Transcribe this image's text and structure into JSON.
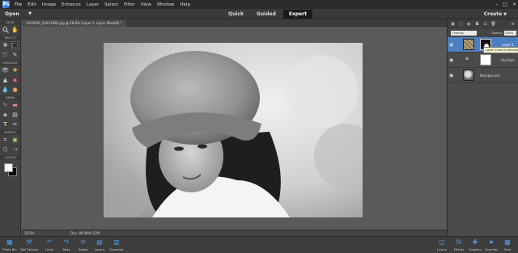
{
  "menubar": {
    "logo": "Ps",
    "items": [
      "File",
      "Edit",
      "Image",
      "Enhance",
      "Layer",
      "Select",
      "Filter",
      "View",
      "Window",
      "Help"
    ],
    "window_controls": [
      "–",
      "□",
      "✕"
    ]
  },
  "modebar": {
    "open_label": "Open",
    "tabs": [
      "Quick",
      "Guided",
      "Expert"
    ],
    "active_tab": "Expert",
    "create_label": "Create"
  },
  "toolbar": {
    "sections": [
      "VIEW",
      "SELECT",
      "ENHANCE",
      "DRAW",
      "MODIFY",
      "COLOR"
    ]
  },
  "document": {
    "tab_title": "1419045_23011694.jpg @ 28.8% (Layer 1, Layer Mask/8) *",
    "zoom": "28.8%",
    "doc_info": "Doc: 88.9M/4.52M"
  },
  "layers_panel": {
    "blend_mode": "Overlay",
    "opacity_label": "Opacity:",
    "opacity_value": "100%",
    "tooltip": "Layer mask thumbnail",
    "layers": [
      {
        "name": "Layer 1",
        "selected": true
      },
      {
        "name": "Hue/Sat...",
        "selected": false
      },
      {
        "name": "Background",
        "selected": false
      }
    ]
  },
  "bottombar": {
    "left": [
      {
        "icon": "photo-bin-icon",
        "label": "Photo Bin"
      },
      {
        "icon": "tool-options-icon",
        "label": "Tool Options"
      },
      {
        "icon": "undo-icon",
        "label": "Undo"
      },
      {
        "icon": "redo-icon",
        "label": "Redo"
      },
      {
        "icon": "rotate-icon",
        "label": "Rotate"
      },
      {
        "icon": "layout-icon",
        "label": "Layout"
      },
      {
        "icon": "organizer-icon",
        "label": "Organizer"
      }
    ],
    "right": [
      {
        "icon": "layers-icon",
        "label": "Layers"
      },
      {
        "icon": "effects-icon",
        "label": "Effects"
      },
      {
        "icon": "graphics-icon",
        "label": "Graphics"
      },
      {
        "icon": "favorites-icon",
        "label": "Favorites"
      },
      {
        "icon": "more-icon",
        "label": "More"
      }
    ]
  },
  "colors": {
    "selection_blue": "#4c7fc0",
    "accent_blue": "#4d9be6",
    "foreground": "#ffffff",
    "background": "#000000"
  }
}
